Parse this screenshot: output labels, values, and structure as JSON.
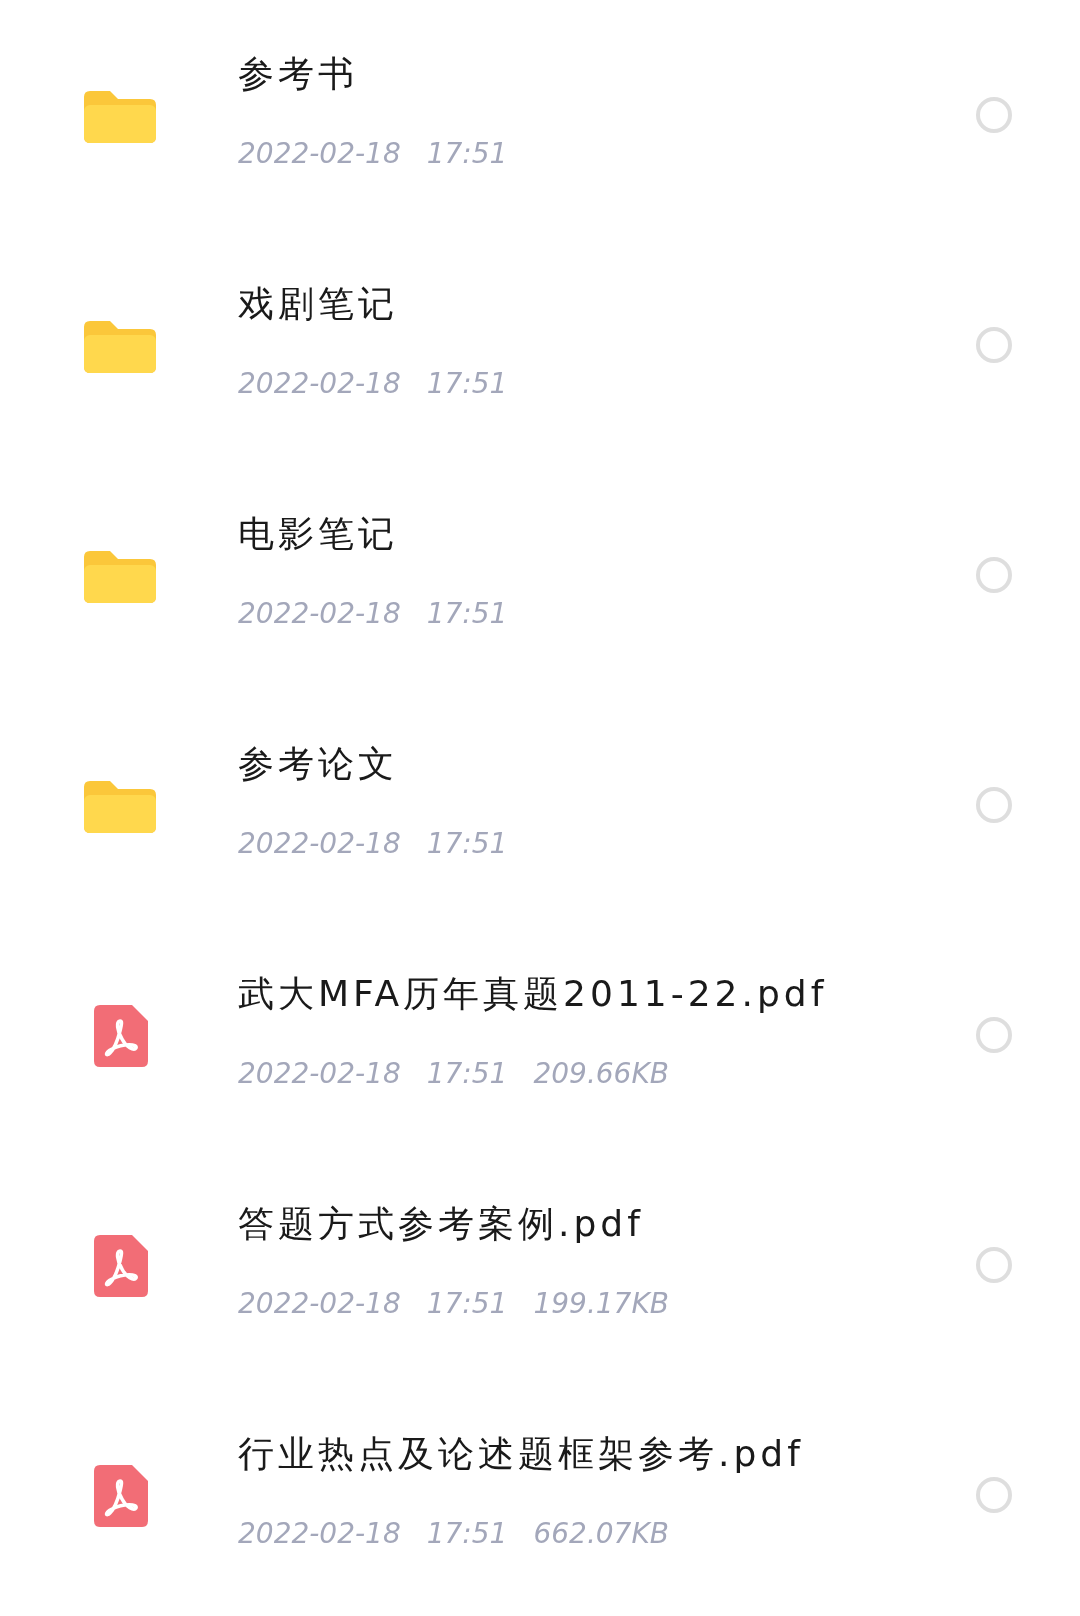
{
  "files": [
    {
      "kind": "folder",
      "name": "参考书",
      "date": "2022-02-18",
      "time": "17:51",
      "selected": false
    },
    {
      "kind": "folder",
      "name": "戏剧笔记",
      "date": "2022-02-18",
      "time": "17:51",
      "selected": false
    },
    {
      "kind": "folder",
      "name": "电影笔记",
      "date": "2022-02-18",
      "time": "17:51",
      "selected": false
    },
    {
      "kind": "folder",
      "name": "参考论文",
      "date": "2022-02-18",
      "time": "17:51",
      "selected": false
    },
    {
      "kind": "pdf",
      "name": "武大MFA历年真题2011-22.pdf",
      "date": "2022-02-18",
      "time": "17:51",
      "size": "209.66KB",
      "selected": false
    },
    {
      "kind": "pdf",
      "name": "答题方式参考案例.pdf",
      "date": "2022-02-18",
      "time": "17:51",
      "size": "199.17KB",
      "selected": false
    },
    {
      "kind": "pdf",
      "name": "行业热点及论述题框架参考.pdf",
      "date": "2022-02-18",
      "time": "17:51",
      "size": "662.07KB",
      "selected": false
    }
  ]
}
